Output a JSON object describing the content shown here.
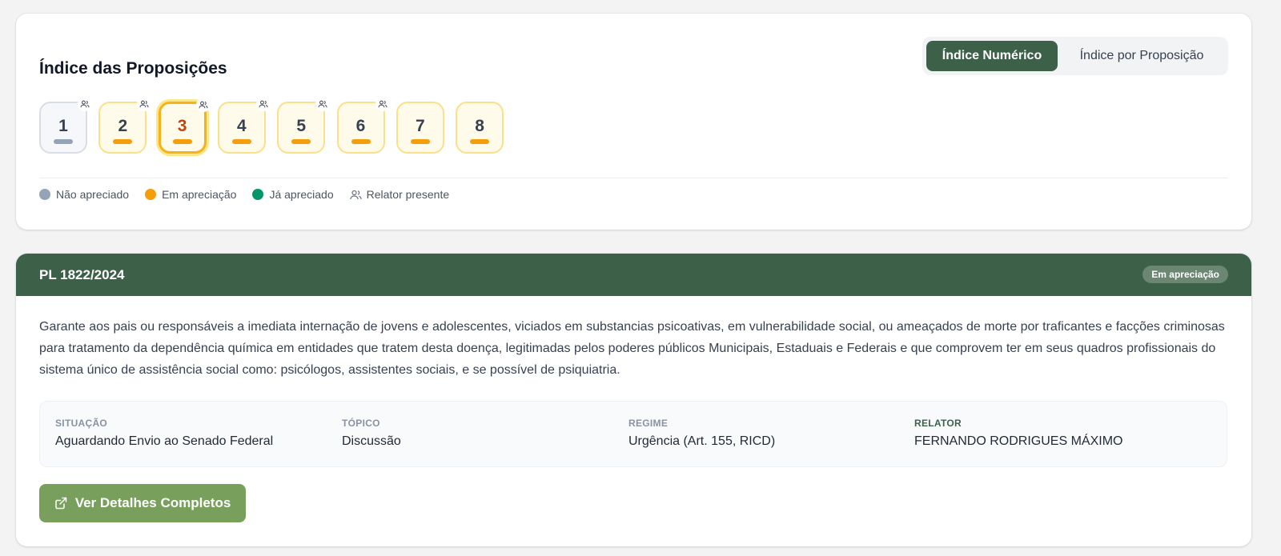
{
  "index": {
    "title": "Índice das Proposições",
    "toggle": {
      "numeric": "Índice Numérico",
      "by_proposition": "Índice por Proposição"
    },
    "chips": [
      {
        "label": "1",
        "status": "nao-apreciado",
        "relator": true,
        "selected": false
      },
      {
        "label": "2",
        "status": "em-apreciacao",
        "relator": true,
        "selected": false
      },
      {
        "label": "3",
        "status": "em-apreciacao",
        "relator": true,
        "selected": true
      },
      {
        "label": "4",
        "status": "em-apreciacao",
        "relator": true,
        "selected": false
      },
      {
        "label": "5",
        "status": "em-apreciacao",
        "relator": true,
        "selected": false
      },
      {
        "label": "6",
        "status": "em-apreciacao",
        "relator": true,
        "selected": false
      },
      {
        "label": "7",
        "status": "em-apreciacao",
        "relator": false,
        "selected": false
      },
      {
        "label": "8",
        "status": "em-apreciacao",
        "relator": false,
        "selected": false
      }
    ],
    "legend": {
      "nao_apreciado": "Não apreciado",
      "em_apreciacao": "Em apreciação",
      "ja_apreciado": "Já apreciado",
      "relator_presente": "Relator presente"
    },
    "colors": {
      "nao_apreciado": "#94a3b8",
      "em_apreciacao": "#f59e0b",
      "ja_apreciado": "#059669",
      "accent": "#3d6049"
    }
  },
  "proposition": {
    "code": "PL 1822/2024",
    "status_badge": "Em apreciação",
    "description": "Garante aos pais ou responsáveis a imediata internação de jovens e adolescentes, viciados em substancias psicoativas, em vulnerabilidade social, ou ameaçados de morte por traficantes e facções criminosas para tratamento da dependência química em entidades que tratem desta doença, legitimadas pelos poderes públicos Municipais, Estaduais e Federais e que comprovem ter em seus quadros profissionais do sistema único de assistência social como: psicólogos, assistentes sociais, e se possível de psiquiatria.",
    "info": {
      "situacao": {
        "label": "SITUAÇÃO",
        "value": "Aguardando Envio ao Senado Federal"
      },
      "topico": {
        "label": "TÓPICO",
        "value": "Discussão"
      },
      "regime": {
        "label": "REGIME",
        "value": "Urgência (Art. 155, RICD)"
      },
      "relator": {
        "label": "RELATOR",
        "value": "FERNANDO RODRIGUES MÁXIMO"
      }
    },
    "details_button": "Ver Detalhes Completos",
    "icons": {
      "details_button": "external-link-icon",
      "relator": "users-icon"
    }
  }
}
